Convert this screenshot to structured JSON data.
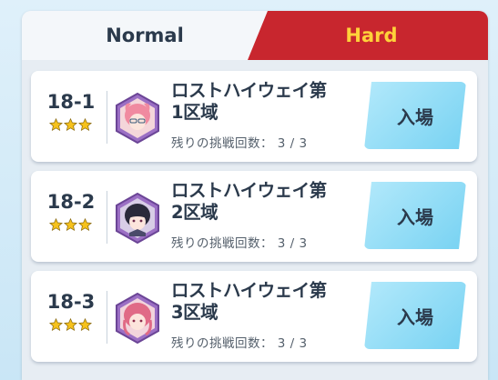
{
  "tabs": {
    "normal_label": "Normal",
    "hard_label": "Hard",
    "active": "Hard"
  },
  "colors": {
    "hard_tab": "#c8262e",
    "hard_tab_text": "#ffd23a",
    "enter_button": "#8fdcf6",
    "star": "#f6c21c"
  },
  "stages": [
    {
      "number": "18-1",
      "stars": 3,
      "title_line1": "ロストハイウェイ第",
      "title_line2": "1区域",
      "attempts": "残りの挑戦回数： 3 / 3",
      "enter_label": "入場",
      "portrait": "pink-haired-girl-with-glasses"
    },
    {
      "number": "18-2",
      "stars": 3,
      "title_line1": "ロストハイウェイ第",
      "title_line2": "2区域",
      "attempts": "残りの挑戦回数： 3 / 3",
      "enter_label": "入場",
      "portrait": "dark-haired-girl"
    },
    {
      "number": "18-3",
      "stars": 3,
      "title_line1": "ロストハイウェイ第",
      "title_line2": "3区域",
      "attempts": "残りの挑戦回数： 3 / 3",
      "enter_label": "入場",
      "portrait": "pink-haired-girl"
    }
  ]
}
